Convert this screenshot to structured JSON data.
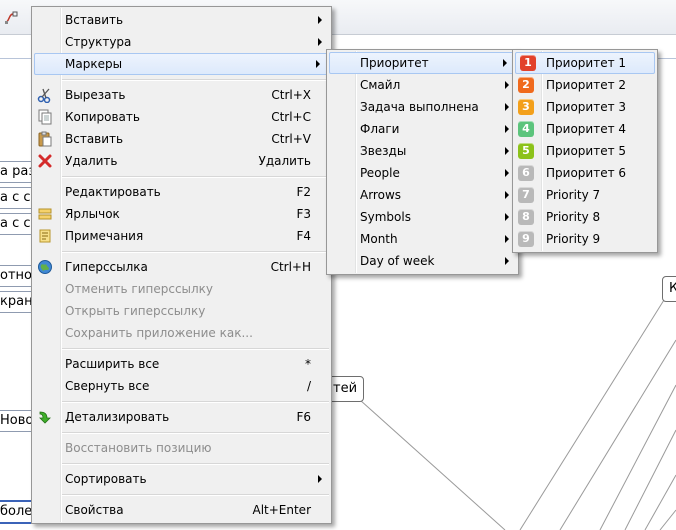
{
  "background": {
    "topics_left": [
      "а разм",
      "а с со",
      "а с со",
      "отнош",
      "кран",
      "Ново",
      "более"
    ],
    "node_right": "К",
    "node_center": "тей"
  },
  "context_menu": {
    "items": [
      {
        "label": "Вставить",
        "shortcut": "",
        "submenu": true,
        "disabled": false
      },
      {
        "label": "Структура",
        "shortcut": "",
        "submenu": true,
        "disabled": false
      },
      {
        "label": "Маркеры",
        "shortcut": "",
        "submenu": true,
        "disabled": false
      },
      {
        "label": "Вырезать",
        "shortcut": "Ctrl+X",
        "icon": "scissors-icon"
      },
      {
        "label": "Копировать",
        "shortcut": "Ctrl+C",
        "icon": "copy-icon"
      },
      {
        "label": "Вставить",
        "shortcut": "Ctrl+V",
        "icon": "paste-icon"
      },
      {
        "label": "Удалить",
        "shortcut": "Удалить",
        "icon": "delete-icon"
      },
      {
        "label": "Редактировать",
        "shortcut": "F2"
      },
      {
        "label": "Ярлычок",
        "shortcut": "F3",
        "icon": "label-icon"
      },
      {
        "label": "Примечания",
        "shortcut": "F4",
        "icon": "notes-icon"
      },
      {
        "label": "Гиперссылка",
        "shortcut": "Ctrl+H",
        "icon": "globe-icon"
      },
      {
        "label": "Отменить гиперссылку",
        "shortcut": "",
        "disabled": true
      },
      {
        "label": "Открыть гиперссылку",
        "shortcut": "",
        "disabled": true
      },
      {
        "label": "Сохранить приложение как...",
        "shortcut": "",
        "disabled": true
      },
      {
        "label": "Расширить все",
        "shortcut": "*"
      },
      {
        "label": "Свернуть все",
        "shortcut": "/"
      },
      {
        "label": "Детализировать",
        "shortcut": "F6",
        "icon": "drill-down-icon"
      },
      {
        "label": "Восстановить позицию",
        "shortcut": "",
        "disabled": true
      },
      {
        "label": "Сортировать",
        "shortcut": "",
        "submenu": true
      },
      {
        "label": "Свойства",
        "shortcut": "Alt+Enter"
      }
    ]
  },
  "markers_menu": {
    "items": [
      "Приоритет",
      "Смайл",
      "Задача выполнена",
      "Флаги",
      "Звезды",
      "People",
      "Arrows",
      "Symbols",
      "Month",
      "Day of week"
    ]
  },
  "priority_menu": {
    "items": [
      {
        "num": "1",
        "label": "Приоритет 1",
        "color": "#e2412b"
      },
      {
        "num": "2",
        "label": "Приоритет 2",
        "color": "#f06a1d"
      },
      {
        "num": "3",
        "label": "Приоритет 3",
        "color": "#f3a01b"
      },
      {
        "num": "4",
        "label": "Приоритет 4",
        "color": "#5cc47c"
      },
      {
        "num": "5",
        "label": "Приоритет 5",
        "color": "#8cc21a"
      },
      {
        "num": "6",
        "label": "Приоритет 6",
        "color": "#b9b9b9"
      },
      {
        "num": "7",
        "label": "Priority 7",
        "color": "#b9b9b9"
      },
      {
        "num": "8",
        "label": "Priority 8",
        "color": "#b9b9b9"
      },
      {
        "num": "9",
        "label": "Priority 9",
        "color": "#b9b9b9"
      }
    ]
  }
}
